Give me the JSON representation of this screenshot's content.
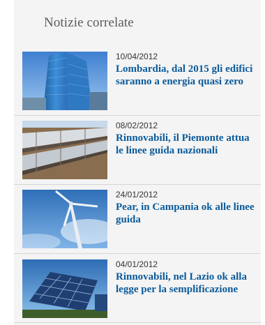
{
  "related": {
    "heading": "Notizie correlate",
    "accent_color": "#0a5a9a",
    "items": [
      {
        "date": "10/04/2012",
        "title": "Lombardia, dal 2015 gli edifici saranno a energia quasi zero",
        "image": "glass-office-building"
      },
      {
        "date": "08/02/2012",
        "title": "Rinnovabili, il Piemonte attua le linee guida nazionali",
        "image": "solar-trough-mirrors"
      },
      {
        "date": "24/01/2012",
        "title": "Pear, in Campania ok alle linee guida",
        "image": "wind-turbine"
      },
      {
        "date": "04/01/2012",
        "title": "Rinnovabili, nel Lazio ok alla legge per la semplificazione",
        "image": "solar-panels"
      }
    ]
  }
}
